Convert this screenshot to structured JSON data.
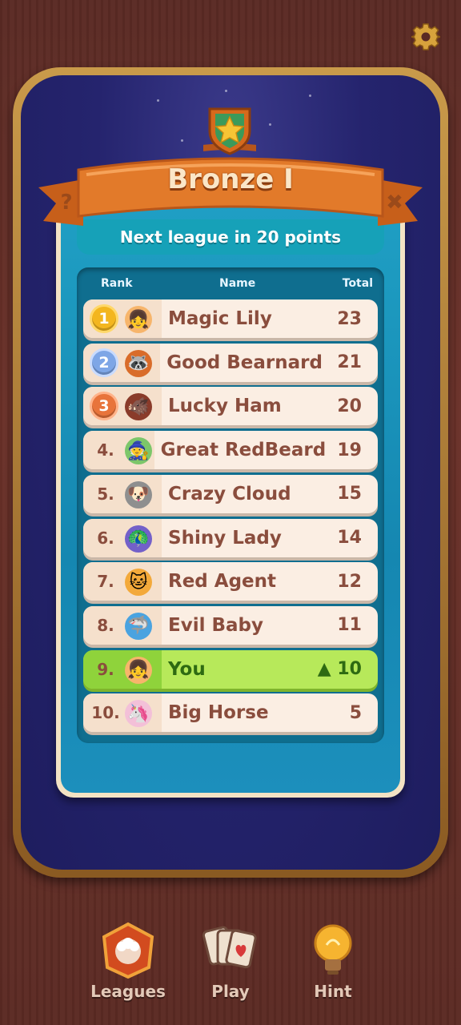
{
  "league": {
    "title": "Bronze I",
    "subtitle": "Next league in 20 points",
    "help_glyph": "?",
    "close_glyph": "✖"
  },
  "table": {
    "headers": {
      "rank": "Rank",
      "name": "Name",
      "total": "Total"
    },
    "rows": [
      {
        "rank": "1",
        "name": "Magic Lily",
        "total": "23",
        "medal": "gold",
        "avatar": "girl-icon"
      },
      {
        "rank": "2",
        "name": "Good Bearnard",
        "total": "21",
        "medal": "silver",
        "avatar": "raccoon-icon"
      },
      {
        "rank": "3",
        "name": "Lucky Ham",
        "total": "20",
        "medal": "bronze",
        "avatar": "boar-icon"
      },
      {
        "rank": "4.",
        "name": "Great RedBeard",
        "total": "19",
        "avatar": "gnome-icon"
      },
      {
        "rank": "5.",
        "name": "Crazy Cloud",
        "total": "15",
        "avatar": "dog-icon"
      },
      {
        "rank": "6.",
        "name": "Shiny Lady",
        "total": "14",
        "avatar": "peacock-icon"
      },
      {
        "rank": "7.",
        "name": "Red Agent",
        "total": "12",
        "avatar": "cat-icon"
      },
      {
        "rank": "8.",
        "name": "Evil Baby",
        "total": "11",
        "avatar": "shark-icon"
      },
      {
        "rank": "9.",
        "name": "You",
        "total": "▲ 10",
        "highlight": true,
        "avatar": "girl-icon"
      },
      {
        "rank": "10.",
        "name": "Big Horse",
        "total": "5",
        "avatar": "unicorn-icon"
      }
    ]
  },
  "nav": {
    "leagues": "Leagues",
    "play": "Play",
    "hint": "Hint"
  },
  "icons": {
    "settings": "gear-icon",
    "league_emblem": "star-shield-icon"
  },
  "colors": {
    "ribbon": "#e27a2a",
    "you_row": "#b7e95a",
    "panel": "#1f9fc4"
  }
}
